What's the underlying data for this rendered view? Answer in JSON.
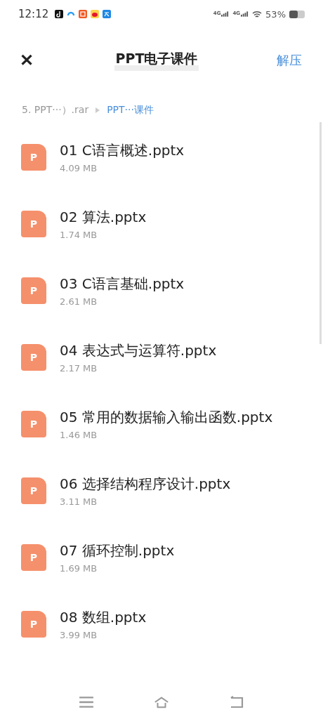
{
  "status_bar": {
    "time": "12:12",
    "network_1": "4G",
    "network_2": "4G",
    "battery": "53%"
  },
  "header": {
    "close": "✕",
    "title": "PPT电子课件",
    "action": "解压"
  },
  "breadcrumb": [
    {
      "label": "5. PPT···）.rar",
      "selected": false
    },
    {
      "label": "PPT···课件",
      "selected": true
    }
  ],
  "files": [
    {
      "icon": "P",
      "name": "01  C语言概述.pptx",
      "size": "4.09 MB"
    },
    {
      "icon": "P",
      "name": "02  算法.pptx",
      "size": "1.74 MB"
    },
    {
      "icon": "P",
      "name": "03  C语言基础.pptx",
      "size": "2.61 MB"
    },
    {
      "icon": "P",
      "name": "04  表达式与运算符.pptx",
      "size": "2.17 MB"
    },
    {
      "icon": "P",
      "name": "05  常用的数据输入输出函数.pptx",
      "size": "1.46 MB"
    },
    {
      "icon": "P",
      "name": "06  选择结构程序设计.pptx",
      "size": "3.11 MB"
    },
    {
      "icon": "P",
      "name": "07 循环控制.pptx",
      "size": "1.69 MB"
    },
    {
      "icon": "P",
      "name": "08  数组.pptx",
      "size": "3.99 MB"
    }
  ]
}
